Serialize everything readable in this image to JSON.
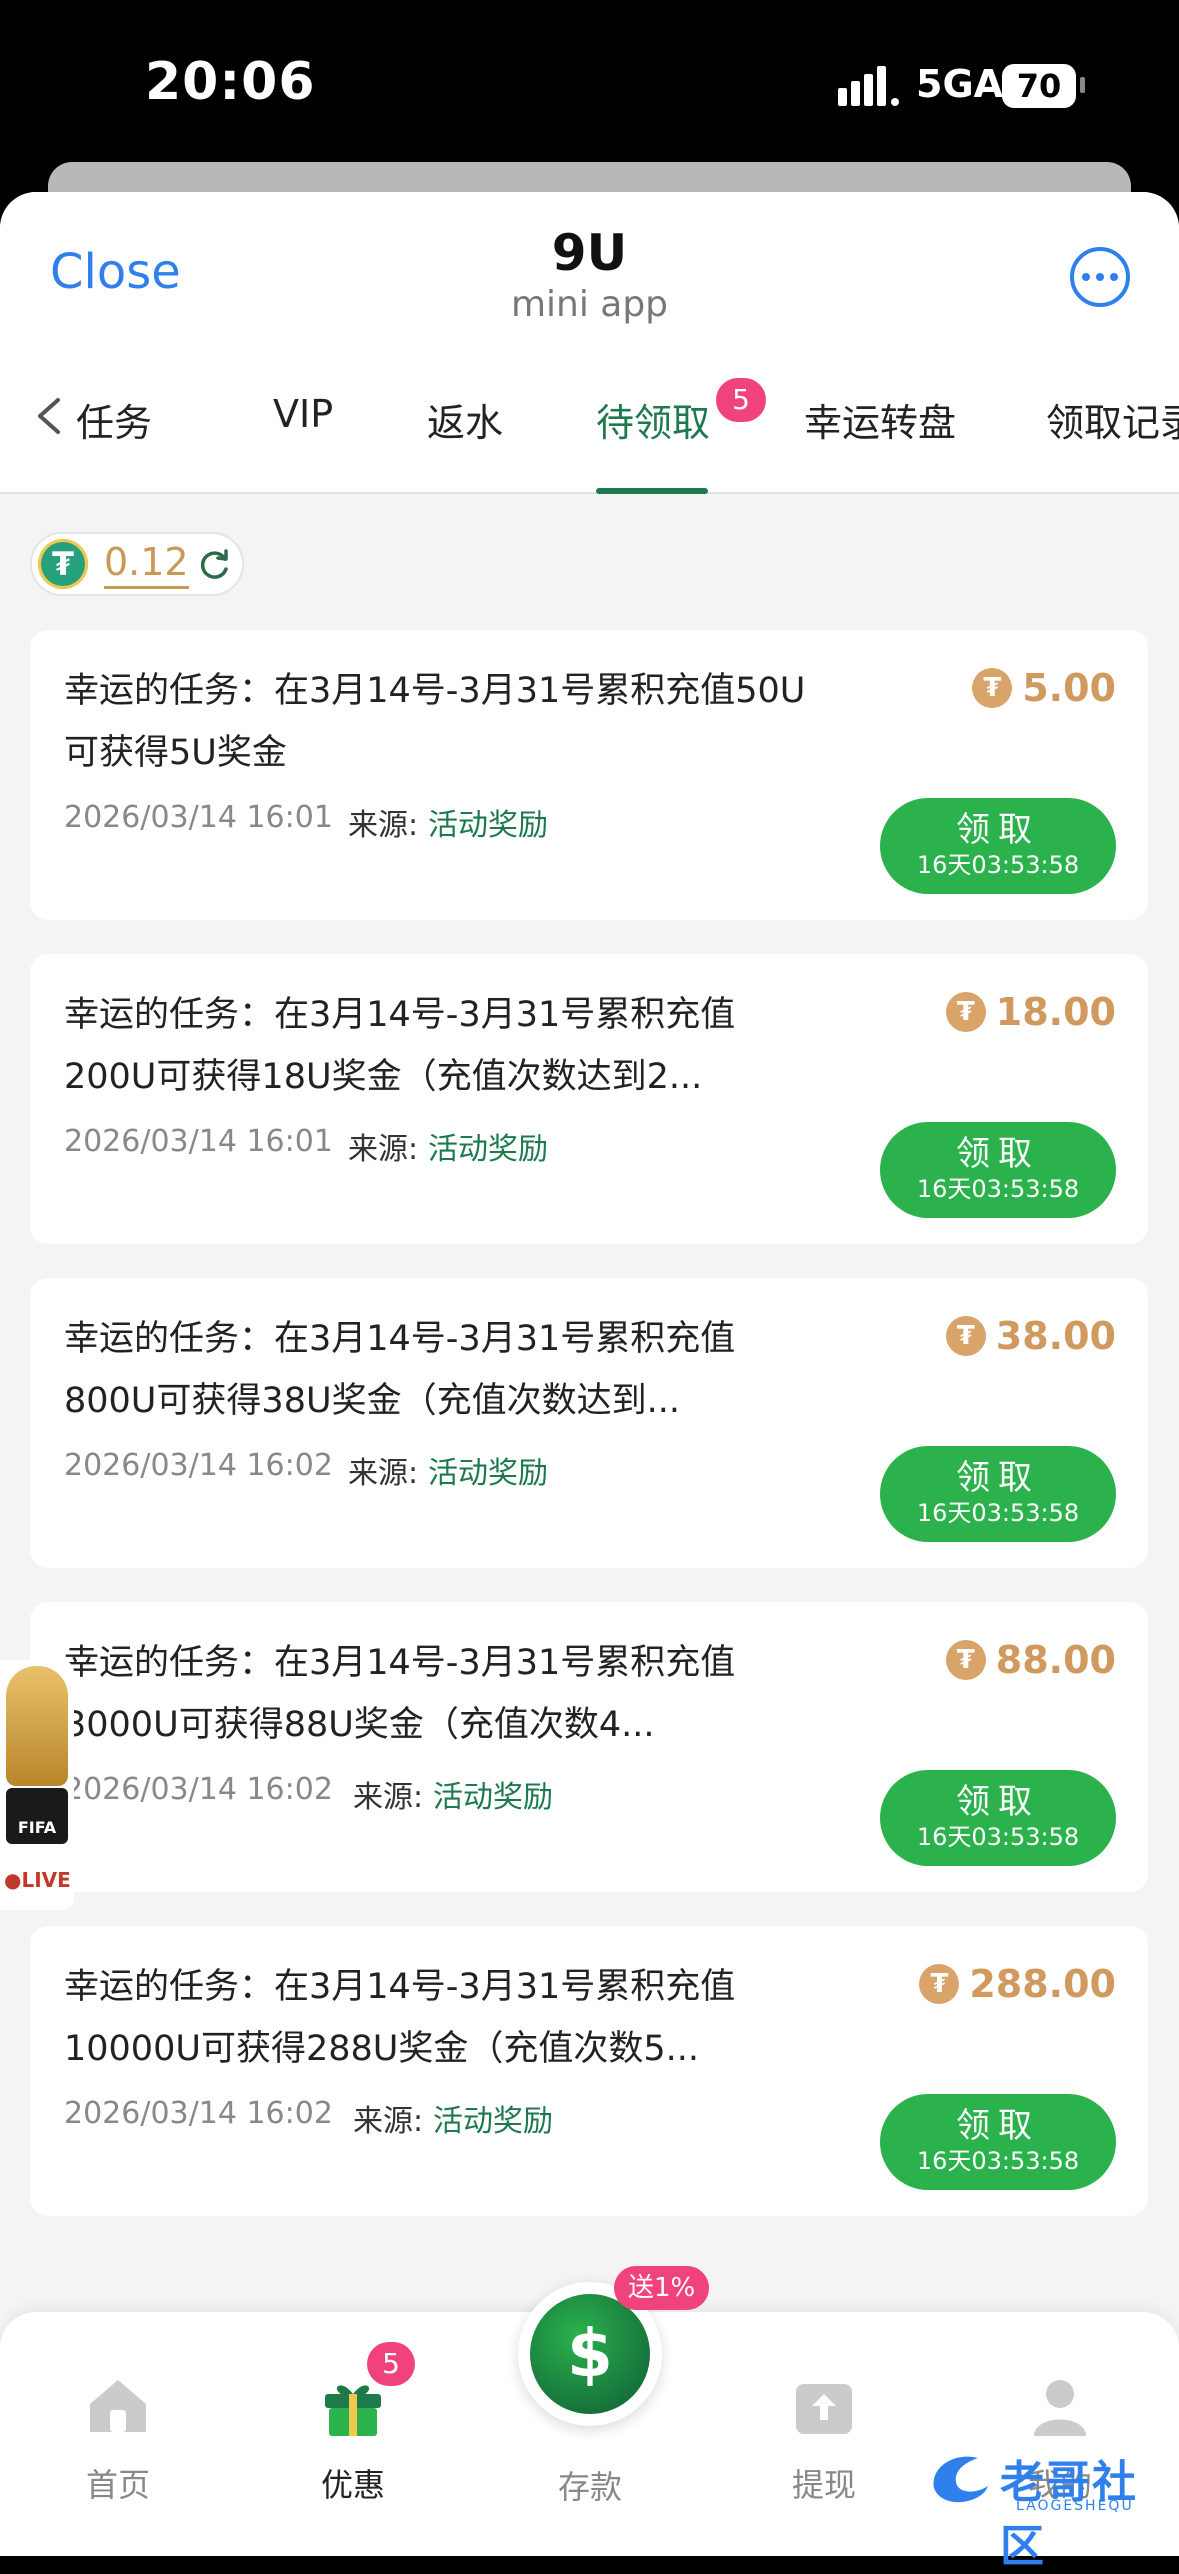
{
  "status_bar": {
    "time": "20:06",
    "network": "5GA",
    "battery": "70"
  },
  "header": {
    "close": "Close",
    "title": "9U",
    "subtitle": "mini app"
  },
  "tabs": [
    {
      "label": "任务",
      "active": false
    },
    {
      "label": "VIP",
      "active": false
    },
    {
      "label": "返水",
      "active": false
    },
    {
      "label": "待领取",
      "active": true,
      "badge": "5"
    },
    {
      "label": "幸运转盘",
      "active": false
    },
    {
      "label": "领取记录",
      "active": false
    }
  ],
  "balance": {
    "value": "0.12"
  },
  "source_label": "来源:",
  "claim_label": "领取",
  "tasks": [
    {
      "title": "幸运的任务：在3月14号-3月31号累积充值50U可获得5U奖金",
      "amount": "5.00",
      "date": "2026/03/14 16:01",
      "source": "活动奖励",
      "timer": "16天03:53:58"
    },
    {
      "title": "幸运的任务：在3月14号-3月31号累积充值200U可获得18U奖金（充值次数达到2...",
      "amount": "18.00",
      "date": "2026/03/14 16:01",
      "source": "活动奖励",
      "timer": "16天03:53:58"
    },
    {
      "title": "幸运的任务：在3月14号-3月31号累积充值800U可获得38U奖金（充值次数达到...",
      "amount": "38.00",
      "date": "2026/03/14 16:02",
      "source": "活动奖励",
      "timer": "16天03:53:58"
    },
    {
      "title": "幸运的任务：在3月14号-3月31号累积充值3000U可获得88U奖金（充值次数4...",
      "amount": "88.00",
      "date": "2026/03/14 16:02",
      "source": "活动奖励",
      "timer": "16天03:53:58"
    },
    {
      "title": "幸运的任务：在3月14号-3月31号累积充值10000U可获得288U奖金（充值次数5...",
      "amount": "288.00",
      "date": "2026/03/14 16:02",
      "source": "活动奖励",
      "timer": "16天03:53:58"
    }
  ],
  "fifa": {
    "badge": "FIFA",
    "live": "LIVE"
  },
  "bottom_nav": {
    "home": "首页",
    "promo": "优惠",
    "promo_badge": "5",
    "deposit": "存款",
    "deposit_tag": "送1%",
    "withdraw": "提现",
    "mine": "我的"
  },
  "watermark": {
    "text": "老哥社区",
    "sub": "LAOGESHEQU"
  },
  "colors": {
    "accent_green": "#1d7a4e",
    "button_green": "#2bb24c",
    "badge_pink": "#f0437b",
    "link_blue": "#2f80ed",
    "amount_gold": "#d09a5e"
  }
}
